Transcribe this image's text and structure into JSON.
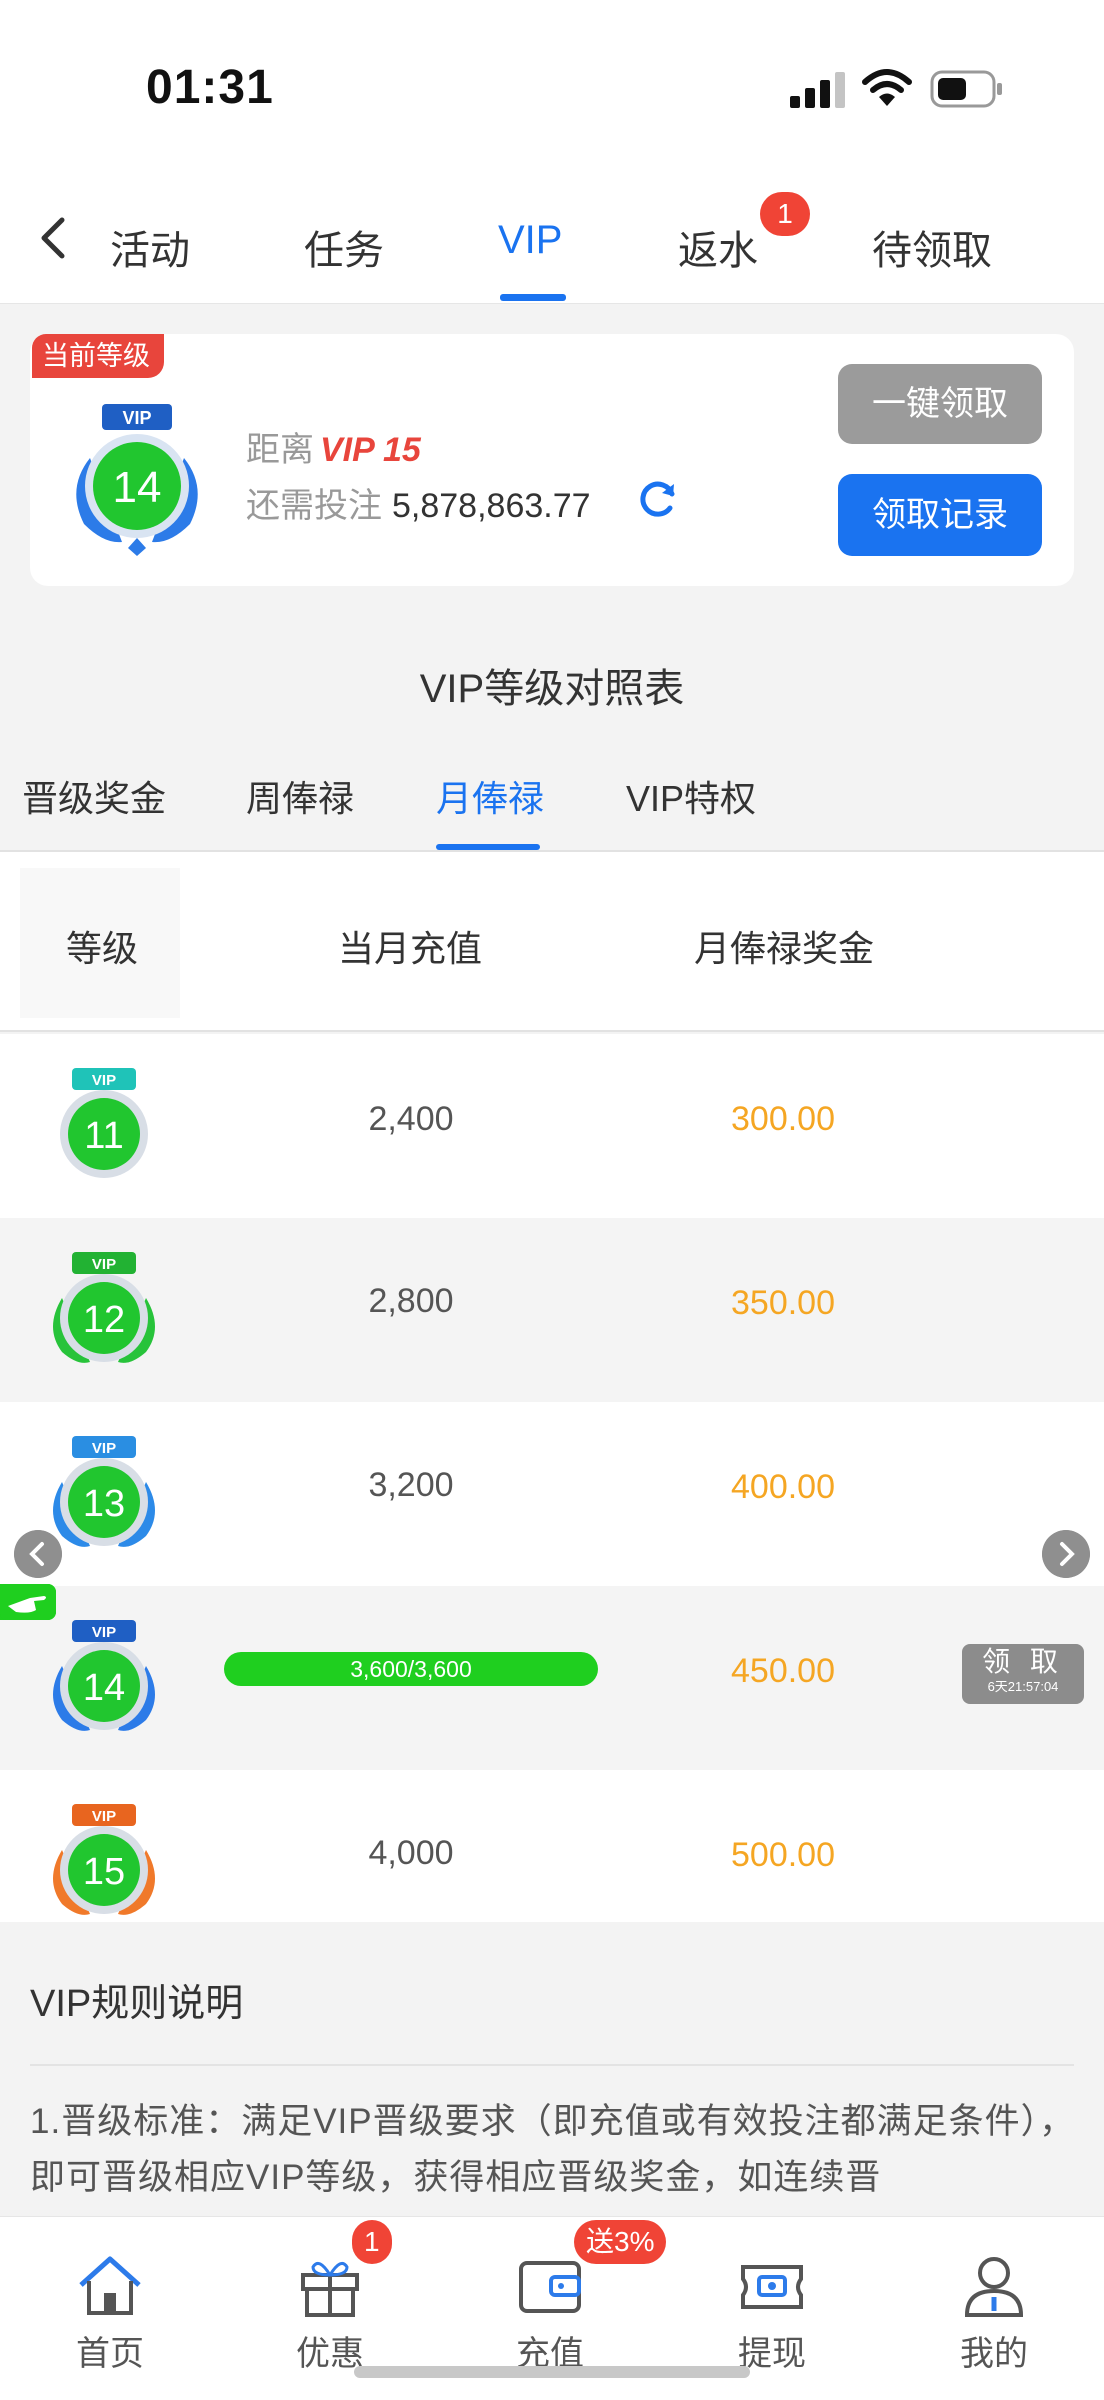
{
  "status_bar": {
    "time": "01:31"
  },
  "top_tabs": [
    {
      "label": "活动"
    },
    {
      "label": "任务"
    },
    {
      "label": "VIP"
    },
    {
      "label": "返水",
      "badge": "1"
    },
    {
      "label": "待领取"
    }
  ],
  "level_card": {
    "tag": "当前等级",
    "current_level": "14",
    "distance_label": "距离",
    "next_level": "VIP 15",
    "need_label": "还需投注",
    "need_amount": "5,878,863.77",
    "claim_all_button": "一键领取",
    "records_button": "领取记录"
  },
  "section_title": "VIP等级对照表",
  "sub_tabs": [
    {
      "label": "晋级奖金"
    },
    {
      "label": "周俸禄"
    },
    {
      "label": "月俸禄"
    },
    {
      "label": "VIP特权"
    }
  ],
  "table": {
    "headers": [
      "等级",
      "当月充值",
      "月俸禄奖金"
    ],
    "rows": [
      {
        "level": "11",
        "recharge": "2,400",
        "bonus": "300.00"
      },
      {
        "level": "12",
        "recharge": "2,800",
        "bonus": "350.00"
      },
      {
        "level": "13",
        "recharge": "3,200",
        "bonus": "400.00"
      },
      {
        "level": "14",
        "recharge": "3,600/3,600",
        "bonus": "450.00",
        "progress": 1.0
      },
      {
        "level": "15",
        "recharge": "4,000",
        "bonus": "500.00"
      }
    ],
    "claim_button": {
      "label": "领 取",
      "countdown": "6天21:57:04"
    }
  },
  "rules": {
    "title": "VIP规则说明",
    "text": "1.晋级标准：满足VIP晋级要求（即充值或有效投注都满足条件），即可晋级相应VIP等级，获得相应晋级奖金，如连续晋"
  },
  "bottom_nav": [
    {
      "label": "首页",
      "icon": "home-icon"
    },
    {
      "label": "优惠",
      "icon": "gift-icon",
      "badge": "1"
    },
    {
      "label": "充值",
      "icon": "wallet-icon",
      "badge": "送3%"
    },
    {
      "label": "提现",
      "icon": "withdraw-icon"
    },
    {
      "label": "我的",
      "icon": "user-icon"
    }
  ],
  "colors": {
    "accent": "#1a73f0",
    "bonus": "#f5a623",
    "badge": "#f04436",
    "progress": "#1fcf1f",
    "vip_red": "#e8453c"
  }
}
